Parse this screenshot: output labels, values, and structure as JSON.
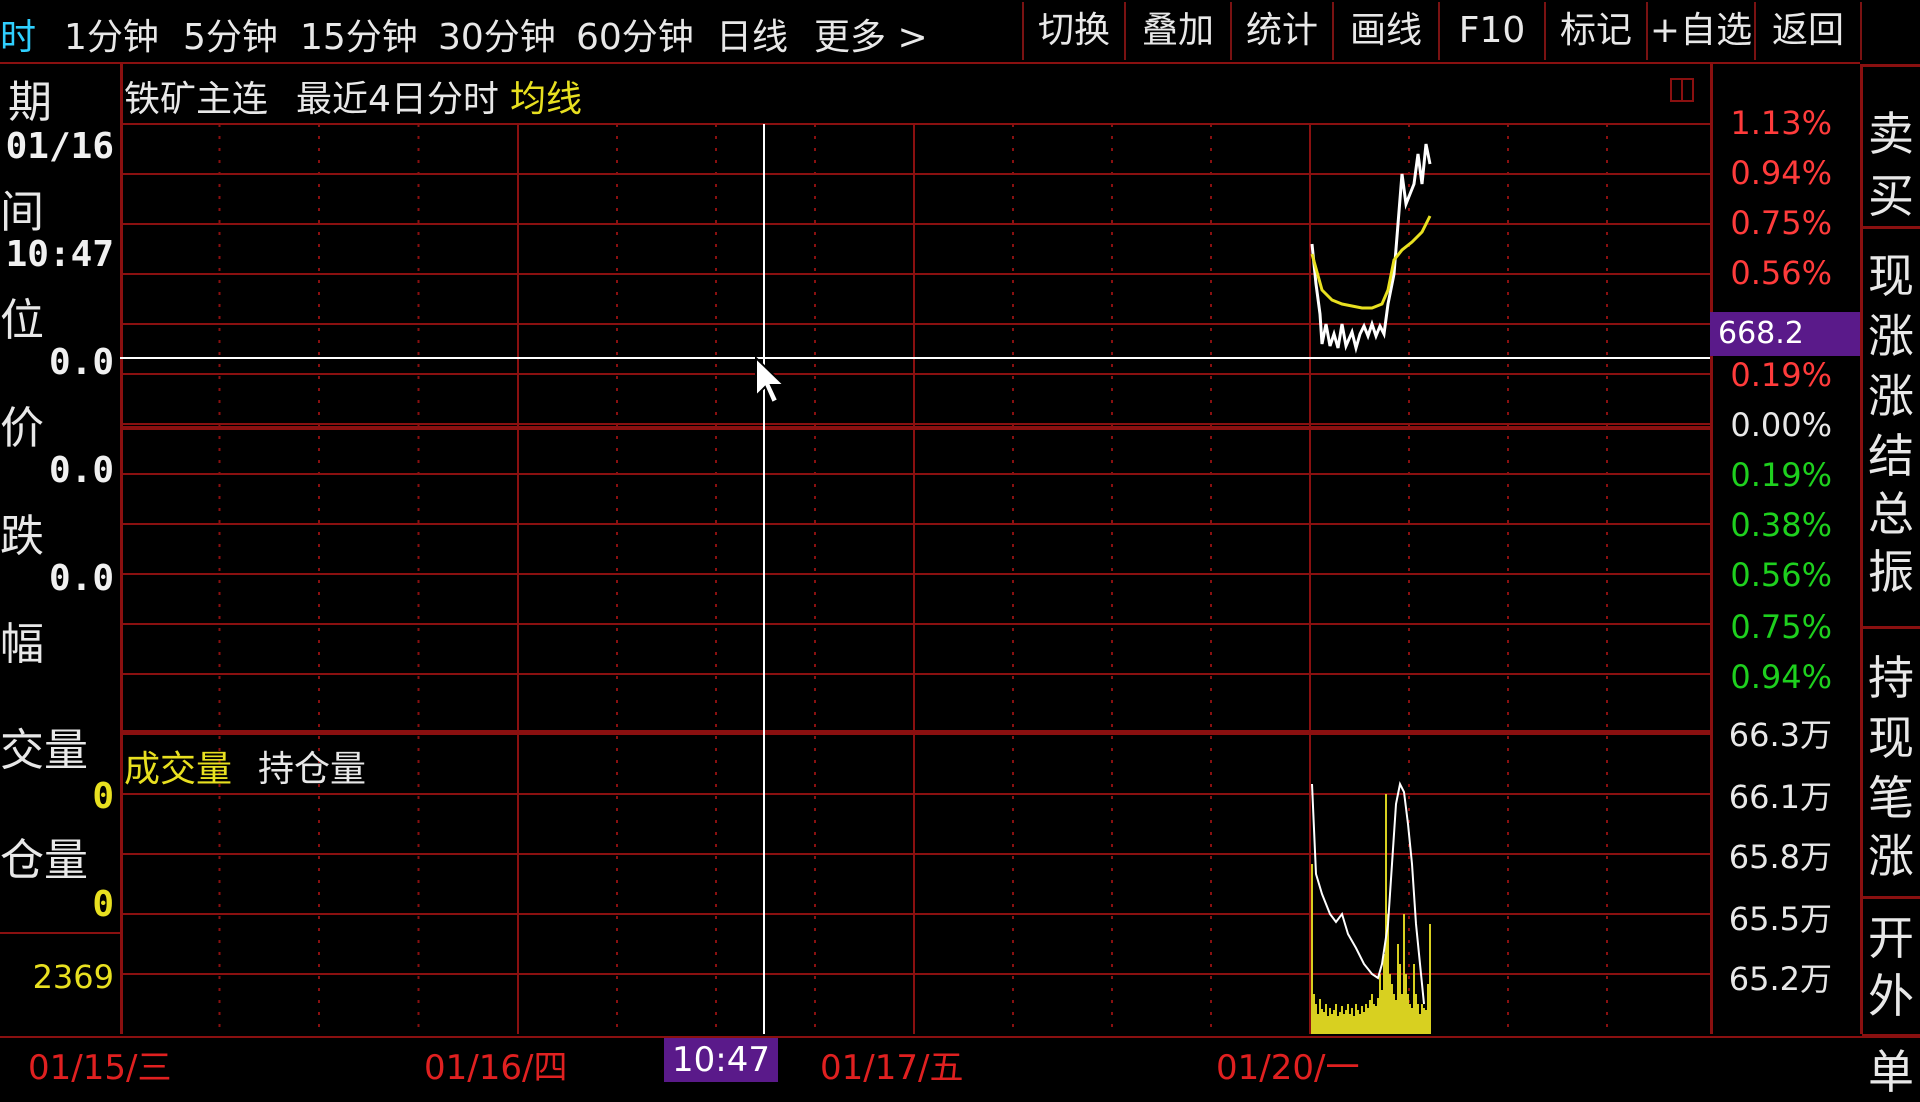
{
  "topbar": {
    "periods": [
      {
        "label": "时",
        "active": true
      },
      {
        "label": "1分钟",
        "active": false
      },
      {
        "label": "5分钟",
        "active": false
      },
      {
        "label": "15分钟",
        "active": false
      },
      {
        "label": "30分钟",
        "active": false
      },
      {
        "label": "60分钟",
        "active": false
      },
      {
        "label": "日线",
        "active": false
      },
      {
        "label": "更多 >",
        "active": false
      }
    ],
    "buttons": [
      "切换",
      "叠加",
      "统计",
      "画线",
      "F10",
      "标记",
      "+自选",
      "返回"
    ]
  },
  "left_panel": {
    "date_label": "期",
    "date_value": "01/16",
    "time_label": "间",
    "time_value": "10:47",
    "price_label": "位",
    "price_value": "0.0",
    "avg_label": "价",
    "avg_value": "0.0",
    "change_label": "跌",
    "change_value": "0.0",
    "pct_label": "幅",
    "volume_label": "交量",
    "volume_value": "0",
    "oi_label": "仓量",
    "oi_value": "0",
    "bottom_value": "2369"
  },
  "chart": {
    "title_name": "铁矿主连",
    "title_period": "最近4日分时",
    "title_ma": "均线",
    "sub_title_volume": "成交量",
    "sub_title_oi": "持仓量"
  },
  "axis": {
    "price_labels": [
      {
        "text": "1.13%",
        "color": "red"
      },
      {
        "text": "0.94%",
        "color": "red"
      },
      {
        "text": "0.75%",
        "color": "red"
      },
      {
        "text": "0.56%",
        "color": "red"
      },
      {
        "text": "0.19%",
        "color": "red"
      },
      {
        "text": "0.00%",
        "color": "white"
      },
      {
        "text": "0.19%",
        "color": "green"
      },
      {
        "text": "0.38%",
        "color": "green"
      },
      {
        "text": "0.56%",
        "color": "green"
      },
      {
        "text": "0.75%",
        "color": "green"
      },
      {
        "text": "0.94%",
        "color": "green"
      }
    ],
    "cursor_price": "668.2",
    "volume_labels": [
      "66.3万",
      "66.1万",
      "65.8万",
      "65.5万",
      "65.2万"
    ]
  },
  "right_panel": {
    "chars": [
      "卖",
      "买",
      "现",
      "涨",
      "涨",
      "结",
      "总",
      "振",
      "持",
      "现",
      "笔",
      "涨",
      "开",
      "外",
      "单"
    ]
  },
  "time_axis": {
    "labels": [
      "01/15/三",
      "01/16/四",
      "01/17/五",
      "01/20/一"
    ],
    "cursor_time": "10:47"
  },
  "colors": {
    "grid": "#8a1010",
    "price_line": "#ffffff",
    "avg_line": "#e8e020",
    "volume_bar": "#d8d020",
    "cursor_tag": "#5a1a8a"
  }
}
